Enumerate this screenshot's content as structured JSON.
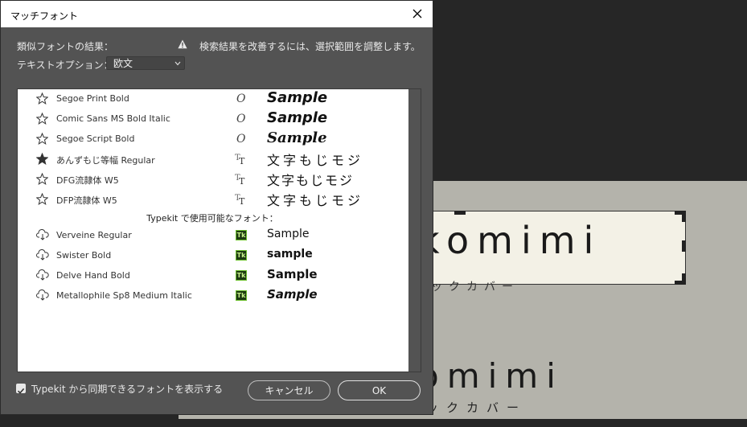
{
  "background": {
    "canvas_text_1": "komimi",
    "canvas_sub_1": "ックカバー",
    "canvas_text_2": "omimi",
    "canvas_sub_2": "ックカバー"
  },
  "dialog": {
    "title": "マッチフォント",
    "results_label": "類似フォントの結果：",
    "warning_text": "検索結果を改善するには、選択範囲を調整します。",
    "text_options_label": "テキストオプション：",
    "text_option_value": "欧文",
    "typekit_section_header": "Typekit で使用可能なフォント：",
    "fonts": [
      {
        "name": "Segoe Print Bold",
        "type_icon": "opentype-icon",
        "sample": "Sample",
        "starred": false
      },
      {
        "name": "Comic Sans MS Bold Italic",
        "type_icon": "opentype-icon",
        "sample": "Sample",
        "starred": false
      },
      {
        "name": "Segoe Script Bold",
        "type_icon": "opentype-icon",
        "sample": "Sample",
        "starred": false
      },
      {
        "name": "あんずもじ等幅  Regular",
        "type_icon": "truetype-icon",
        "sample": "文字もじモジ",
        "starred": true
      },
      {
        "name": "DFG流隷体  W5",
        "type_icon": "truetype-icon",
        "sample": "文字もじモジ",
        "starred": false
      },
      {
        "name": "DFP流隷体  W5",
        "type_icon": "truetype-icon",
        "sample": "文字もじモジ",
        "starred": false
      }
    ],
    "typekit_fonts": [
      {
        "name": "Verveine Regular",
        "badge": "Tk",
        "sample": "Sample"
      },
      {
        "name": "Swister Bold",
        "badge": "Tk",
        "sample": "sample"
      },
      {
        "name": "Delve Hand Bold",
        "badge": "Tk",
        "sample": "Sample"
      },
      {
        "name": "Metallophile Sp8 Medium Italic",
        "badge": "Tk",
        "sample": "Sample"
      }
    ],
    "sync_checkbox_label": "Typekit から同期できるフォントを表示する",
    "sync_checked": true,
    "cancel_label": "キャンセル",
    "ok_label": "OK"
  }
}
